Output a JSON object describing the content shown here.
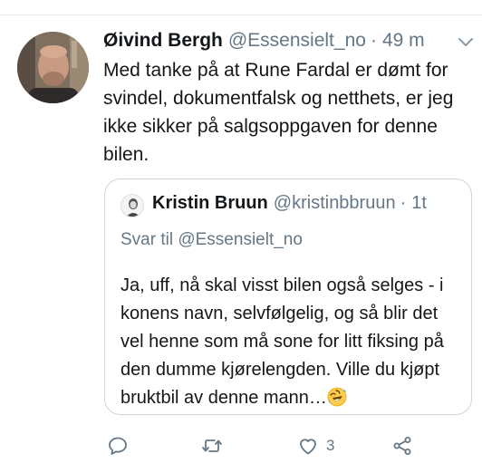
{
  "tweet": {
    "author_name": "Øivind Bergh",
    "author_handle": "@Essensielt_no",
    "separator": "·",
    "time": "49 m",
    "text": "Med tanke på at Rune Fardal er dømt for svindel, dokumentfalsk og netthets, er jeg ikke sikker på salgsoppgaven for denne bilen."
  },
  "quote": {
    "author_name": "Kristin Bruun",
    "author_handle": "@kristinbbruun",
    "separator": "·",
    "time": "1t",
    "replying_to": "Svar til @Essensielt_no",
    "text": "Ja, uff, nå skal visst bilen også selges - i konens navn, selvfølgelig, og så blir det vel henne som må sone for litt fiksing på den dumme kjørelengden. Ville du kjøpt bruktbil av denne mann…",
    "trailing_emoji": "rolling-on-floor-laughing-emoji"
  },
  "actions": {
    "reply_icon": "reply-icon",
    "retweet_icon": "retweet-icon",
    "like_icon": "heart-icon",
    "like_count": "3",
    "share_icon": "share-icon"
  },
  "colors": {
    "text": "#14171a",
    "secondary": "#657786",
    "border": "#ccd6dd"
  }
}
